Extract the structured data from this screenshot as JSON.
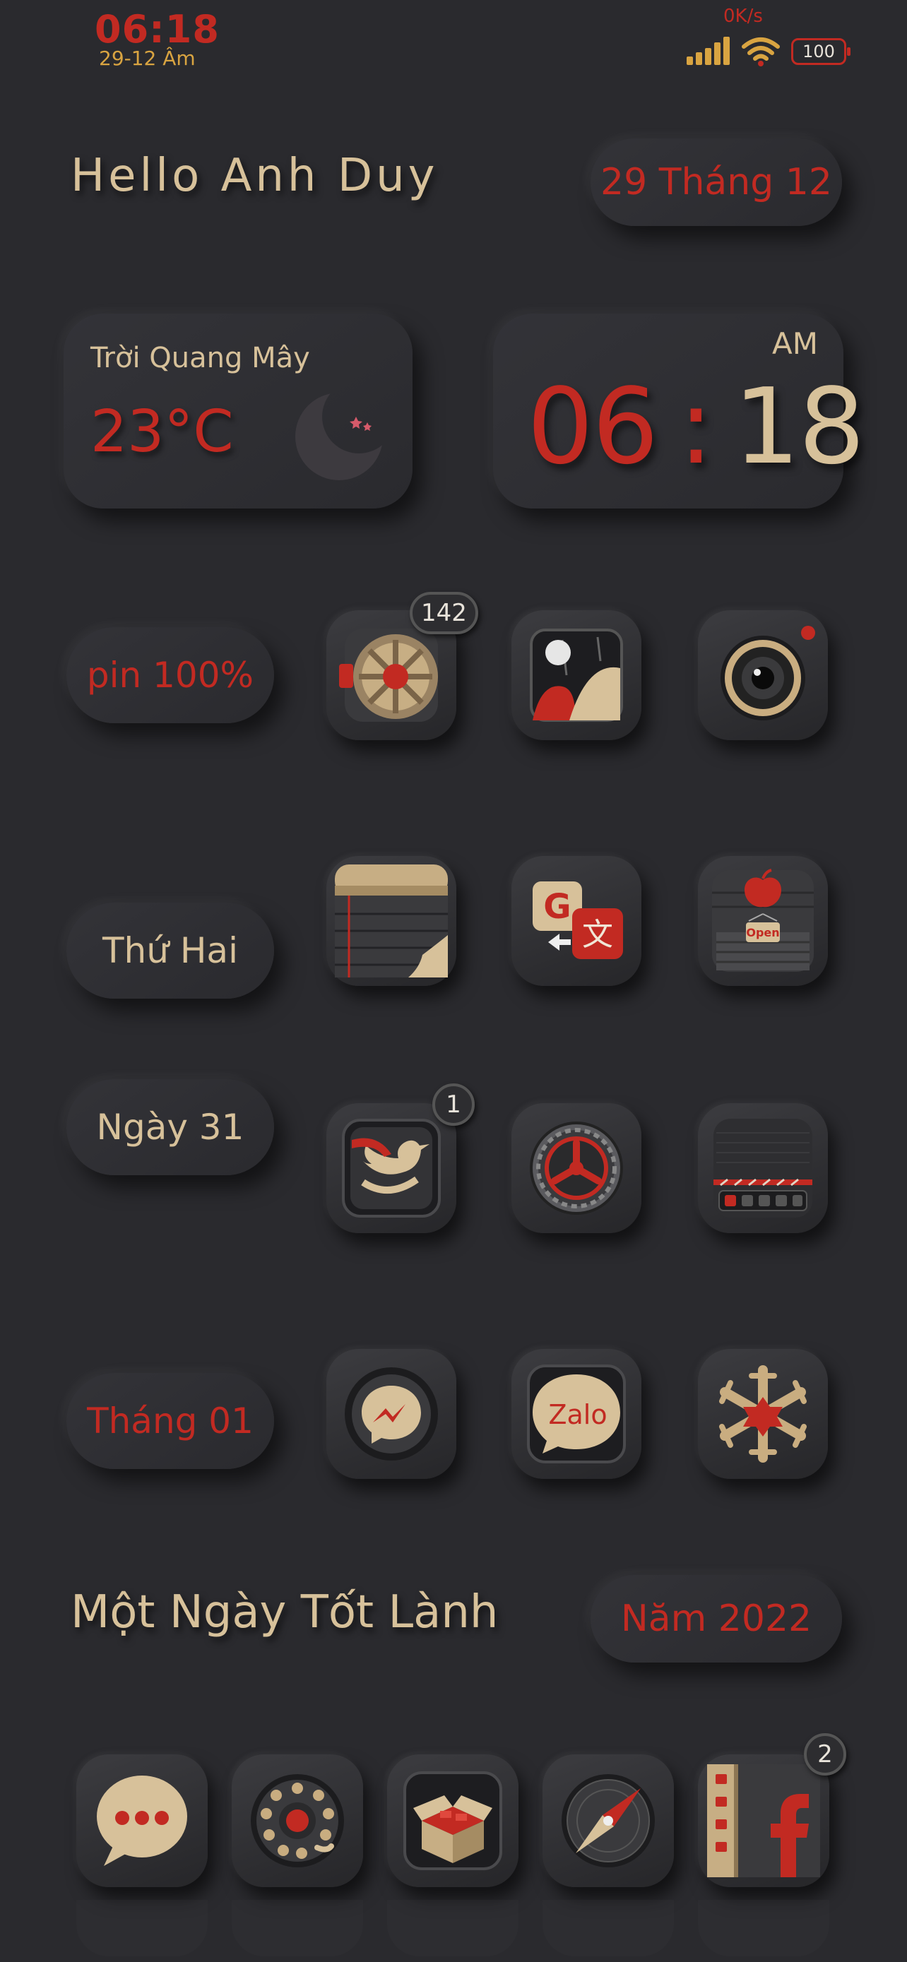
{
  "status_bar": {
    "time": "06:18",
    "lunar_date": "29-12 Âm",
    "net_speed": "0K/s",
    "battery": "100"
  },
  "header": {
    "greeting": "Hello Anh Duy",
    "date_pill": "29 Tháng 12"
  },
  "weather": {
    "condition": "Trời Quang Mây",
    "temperature": "23°C",
    "icon": "moon-stars-icon"
  },
  "clock": {
    "ampm": "AM",
    "hour": "06",
    "separator": ":",
    "minute": "18"
  },
  "side_pills": {
    "battery": "pin 100%",
    "weekday": "Thứ Hai",
    "day": "Ngày 31",
    "month": "Tháng 01"
  },
  "apps": [
    {
      "name": "vault-app-icon",
      "badge": "142"
    },
    {
      "name": "pinball-app-icon",
      "badge": ""
    },
    {
      "name": "camera-app-icon",
      "badge": ""
    },
    {
      "name": "notes-app-icon",
      "badge": ""
    },
    {
      "name": "translate-app-icon",
      "badge": ""
    },
    {
      "name": "app-store-open-icon",
      "badge": "",
      "sign": "Open"
    },
    {
      "name": "twitter-app-icon",
      "badge": "1"
    },
    {
      "name": "settings-gear-app-icon",
      "badge": ""
    },
    {
      "name": "control-panel-app-icon",
      "badge": ""
    },
    {
      "name": "messenger-app-icon",
      "badge": ""
    },
    {
      "name": "zalo-app-icon",
      "badge": "",
      "label": "Zalo"
    },
    {
      "name": "snowflake-app-icon",
      "badge": ""
    }
  ],
  "footer": {
    "motto": "Một Ngày Tốt Lành",
    "year_pill": "Năm 2022"
  },
  "dock": [
    {
      "name": "messages-app-icon",
      "badge": ""
    },
    {
      "name": "phone-dial-app-icon",
      "badge": ""
    },
    {
      "name": "package-box-app-icon",
      "badge": ""
    },
    {
      "name": "compass-app-icon",
      "badge": ""
    },
    {
      "name": "facebook-app-icon",
      "badge": "2"
    }
  ],
  "colors": {
    "background": "#2a2a2e",
    "accent_red": "#c22a22",
    "accent_tan": "#d7c19a",
    "status_gold": "#d9a441"
  }
}
